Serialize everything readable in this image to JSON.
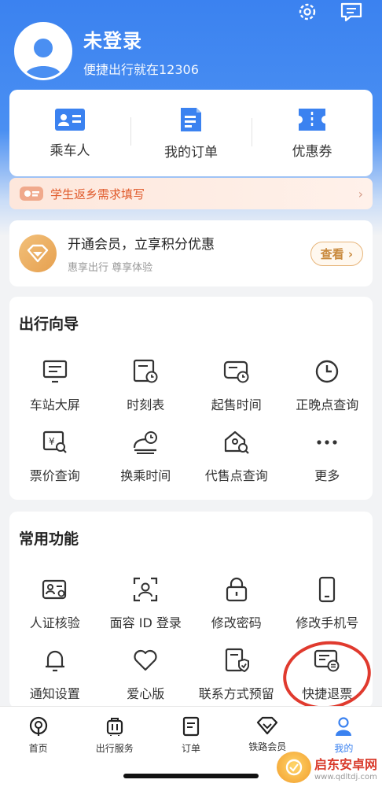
{
  "header": {
    "login_title": "未登录",
    "login_subtitle": "便捷出行就在12306",
    "icons": [
      "gear-icon",
      "message-icon"
    ]
  },
  "quick_actions": [
    {
      "label": "乘车人",
      "icon": "passenger-card-icon"
    },
    {
      "label": "我的订单",
      "icon": "order-doc-icon"
    },
    {
      "label": "优惠券",
      "icon": "coupon-icon"
    }
  ],
  "student_banner": {
    "label": "学生返乡需求填写"
  },
  "vip": {
    "title": "开通会员，立享积分优惠",
    "subtitle": "惠享出行 尊享体验",
    "button": "查看"
  },
  "guide": {
    "title": "出行向导",
    "items": [
      {
        "label": "车站大屏",
        "icon": "station-screen-icon"
      },
      {
        "label": "时刻表",
        "icon": "timetable-icon"
      },
      {
        "label": "起售时间",
        "icon": "sale-time-icon"
      },
      {
        "label": "正晚点查询",
        "icon": "clock-icon"
      },
      {
        "label": "票价查询",
        "icon": "fare-search-icon"
      },
      {
        "label": "换乘时间",
        "icon": "transfer-time-icon"
      },
      {
        "label": "代售点查询",
        "icon": "agency-search-icon"
      },
      {
        "label": "更多",
        "icon": "more-icon"
      }
    ]
  },
  "common": {
    "title": "常用功能",
    "items": [
      {
        "label": "人证核验",
        "icon": "id-verify-icon"
      },
      {
        "label": "面容 ID 登录",
        "icon": "face-id-icon"
      },
      {
        "label": "修改密码",
        "icon": "lock-icon"
      },
      {
        "label": "修改手机号",
        "icon": "phone-icon"
      },
      {
        "label": "通知设置",
        "icon": "bell-icon"
      },
      {
        "label": "爱心版",
        "icon": "heart-icon"
      },
      {
        "label": "联系方式预留",
        "icon": "contact-shield-icon"
      },
      {
        "label": "快捷退票",
        "icon": "quick-refund-icon"
      }
    ]
  },
  "tabbar": [
    {
      "label": "首页",
      "icon": "train-home-icon",
      "active": false
    },
    {
      "label": "出行服务",
      "icon": "luggage-icon",
      "active": false
    },
    {
      "label": "订单",
      "icon": "order-icon",
      "active": false
    },
    {
      "label": "铁路会员",
      "icon": "diamond-icon",
      "active": false
    },
    {
      "label": "我的",
      "icon": "user-icon",
      "active": true
    }
  ],
  "watermark": {
    "name": "启东安卓网",
    "url": "www.qdltdj.com"
  },
  "colors": {
    "primary": "#3b82f0",
    "accent_orange": "#e05a2b",
    "highlight_red": "#e03a2e"
  }
}
